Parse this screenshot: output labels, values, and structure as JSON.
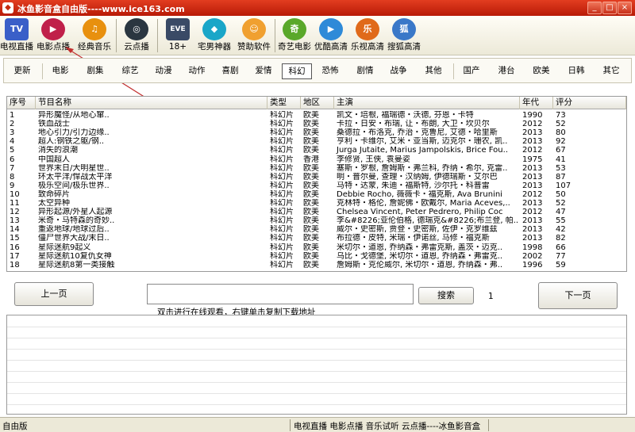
{
  "window": {
    "title": "冰鱼影音盒自由版----www.ice163.com",
    "minimize": "_",
    "maximize": "□",
    "close": "×"
  },
  "toolbar": [
    {
      "label": "电视直播",
      "icon": "tv-icon",
      "glyph": "TV",
      "color": "#3a5fc8"
    },
    {
      "label": "电影点播",
      "icon": "play-circle-icon",
      "glyph": "▶",
      "color": "#c0204a"
    },
    {
      "label": "经典音乐",
      "icon": "headphones-smiley-icon",
      "glyph": "♫",
      "color": "#e8900e"
    },
    {
      "label": "云点播",
      "icon": "target-reel-icon",
      "glyph": "◎",
      "color": "#2a3640"
    },
    {
      "label": "18+",
      "icon": "eve-icon",
      "glyph": "EVE",
      "color": "#3a4a66"
    },
    {
      "label": "宅男神器",
      "icon": "diamond-icon",
      "glyph": "◆",
      "color": "#1aa6c8"
    },
    {
      "label": "赞助软件",
      "icon": "smiley-face-icon",
      "glyph": "☺",
      "color": "#f0a030"
    },
    {
      "label": "奇艺电影",
      "icon": "iqiyi-icon",
      "glyph": "奇",
      "color": "#5aa82a"
    },
    {
      "label": "优酷高清",
      "icon": "youku-play-icon",
      "glyph": "▶",
      "color": "#2e8ad8"
    },
    {
      "label": "乐视高清",
      "icon": "letv-icon",
      "glyph": "乐",
      "color": "#e06a1a"
    },
    {
      "label": "搜狐高清",
      "icon": "sohu-icon",
      "glyph": "狐",
      "color": "#3a78c8"
    }
  ],
  "categories": [
    "更新",
    "电影",
    "剧集",
    "综艺",
    "动漫",
    "动作",
    "喜剧",
    "爱情",
    "科幻",
    "恐怖",
    "剧情",
    "战争",
    "其他",
    "国产",
    "港台",
    "欧美",
    "日韩",
    "其它"
  ],
  "active_category": "科幻",
  "table": {
    "columns": [
      "序号",
      "节目名称",
      "类型",
      "地区",
      "主演",
      "年代",
      "评分"
    ],
    "rows": [
      [
        "1",
        "异形魔怪/从地心窜..",
        "科幻片",
        "欧美",
        "凯文・培根, 福瑞德・沃德, 芬恩・卡特",
        "1990",
        "73"
      ],
      [
        "2",
        "铁血战士",
        "科幻片",
        "欧美",
        "卡拉・日安・布瑞, 让・布朗, 大卫・坎贝尔",
        "2012",
        "52"
      ],
      [
        "3",
        "地心引力/引力边缘..",
        "科幻片",
        "欧美",
        "桑德拉・布洛克, 乔治・克鲁尼, 艾德・哈里斯",
        "2013",
        "80"
      ],
      [
        "4",
        "超人:钢铁之躯/钢..",
        "科幻片",
        "欧美",
        "亨利・卡维尔, 艾米・亚当斯, 迈克尔・珊农, 凯..",
        "2013",
        "92"
      ],
      [
        "5",
        "消失的浪潮",
        "科幻片",
        "欧美",
        "Jurga Jutaite, Marius Jampolskis, Brice Fou..",
        "2012",
        "67"
      ],
      [
        "6",
        "中国超人",
        "科幻片",
        "香港",
        "李修贤, 王侠, 袁曼姿",
        "1975",
        "41"
      ],
      [
        "7",
        "世界末日/大明星世..",
        "科幻片",
        "欧美",
        "塞斯・罗根, 詹姆斯・弗兰科, 乔纳・希尔, 克雷..",
        "2013",
        "53"
      ],
      [
        "8",
        "环太平洋/悍战太平洋",
        "科幻片",
        "欧美",
        "明・普尔曼, 查理・汉纳姆, 伊德瑞斯・艾尔巴",
        "2013",
        "87"
      ],
      [
        "9",
        "极乐空间/极乐世界..",
        "科幻片",
        "欧美",
        "马特・达蒙, 朱迪・福斯特, 沙尔托・科普雷",
        "2013",
        "107"
      ],
      [
        "10",
        "致命碎片",
        "科幻片",
        "欧美",
        "Debbie Rocho, 薇薇卡・福克斯, Ava Brunini",
        "2012",
        "50"
      ],
      [
        "11",
        "太空异种",
        "科幻片",
        "欧美",
        "克林特・格伦, 詹妮佛・欧戴尔, Maria Aceves,..",
        "2013",
        "52"
      ],
      [
        "12",
        "异形起源/外星人起源",
        "科幻片",
        "欧美",
        "Chelsea Vincent, Peter Pedrero, Philip Coc",
        "2012",
        "47"
      ],
      [
        "13",
        "米奇・马特森的奇妙..",
        "科幻片",
        "欧美",
        "李&#8226;亚伦伯格, 德瑞克&#8226;布兰登, 帕..",
        "2013",
        "55"
      ],
      [
        "14",
        "重返地球/地球过后..",
        "科幻片",
        "欧美",
        "威尔・史密斯, 贾登・史密斯, 佐伊・克罗维兹",
        "2013",
        "42"
      ],
      [
        "15",
        "僵尸世界大战/末日..",
        "科幻片",
        "欧美",
        "布拉德・皮特, 米瑞・伊诺丝, 马修・福克斯",
        "2013",
        "82"
      ],
      [
        "16",
        "星际迷航9起义",
        "科幻片",
        "欧美",
        "米切尔・道恩, 乔纳森・弗雷克斯, 盖茨・迈克..",
        "1998",
        "66"
      ],
      [
        "17",
        "星际迷航10复仇女神",
        "科幻片",
        "欧美",
        "乌比・戈德堡, 米切尔・道恩, 乔纳森・弗雷克..",
        "2002",
        "77"
      ],
      [
        "18",
        "星际迷航8第一类接触",
        "科幻片",
        "欧美",
        "詹姆斯・克伦威尔, 米切尔・道恩, 乔纳森・弗..",
        "1996",
        "59"
      ]
    ]
  },
  "controls": {
    "prev_label": "上一页",
    "search_label": "搜索",
    "page_number": "1",
    "next_label": "下一页",
    "hint": "双击进行在线观看，右键单击复制下载地址"
  },
  "status": {
    "left": "自由版",
    "right": "电视直播  电影点播  音乐试听  云点播----冰鱼影音盒"
  }
}
